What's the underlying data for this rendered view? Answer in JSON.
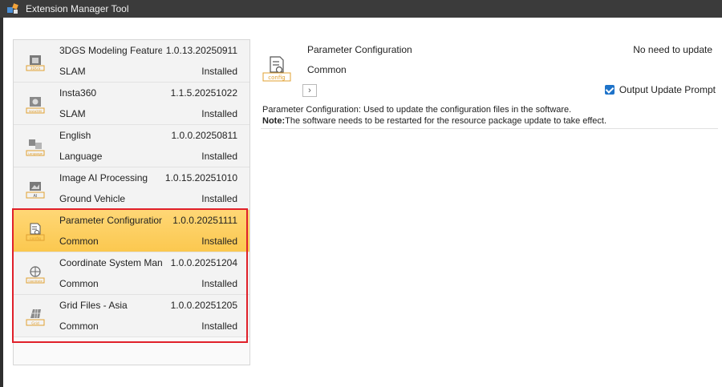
{
  "window": {
    "title": "Extension Manager Tool"
  },
  "extensions": [
    {
      "name": "3DGS Modeling Feature",
      "version": "1.0.13.20250911",
      "category": "SLAM",
      "status": "Installed",
      "icon": "3dgs-icon",
      "icon_text": "3DGS"
    },
    {
      "name": "Insta360",
      "version": "1.1.5.20251022",
      "category": "SLAM",
      "status": "Installed",
      "icon": "insta360-icon",
      "icon_text": "Insta360"
    },
    {
      "name": "English",
      "version": "1.0.0.20250811",
      "category": "Language",
      "status": "Installed",
      "icon": "language-icon",
      "icon_text": "Language"
    },
    {
      "name": "Image AI Processing",
      "version": "1.0.15.20251010",
      "category": "Ground Vehicle",
      "status": "Installed",
      "icon": "ai-icon",
      "icon_text": "AI"
    },
    {
      "name": "Parameter Configuration",
      "version": "1.0.0.20251111",
      "category": "Common",
      "status": "Installed",
      "icon": "config-icon",
      "icon_text": "config",
      "selected": true
    },
    {
      "name": "Coordinate System Manager",
      "version": "1.0.0.20251204",
      "category": "Common",
      "status": "Installed",
      "icon": "coordinate-icon",
      "icon_text": "Coordinate"
    },
    {
      "name": "Grid Files - Asia",
      "version": "1.0.0.20251205",
      "category": "Common",
      "status": "Installed",
      "icon": "grid-icon",
      "icon_text": "Grid"
    }
  ],
  "detail": {
    "name": "Parameter Configuration",
    "category": "Common",
    "update_status": "No need to update",
    "icon_text": "config",
    "output_update_prompt": "Output Update Prompt",
    "output_update_prompt_checked": true,
    "description": "Parameter Configuration: Used to update the configuration files in the software.",
    "note_label": "Note:",
    "note_text": "The software needs to be restarted for the resource package update to take effect."
  },
  "colors": {
    "selected": "#fbc84f",
    "accent": "#1e73c9",
    "highlight_box": "#e0202a",
    "titlebar": "#3b3b3b"
  }
}
